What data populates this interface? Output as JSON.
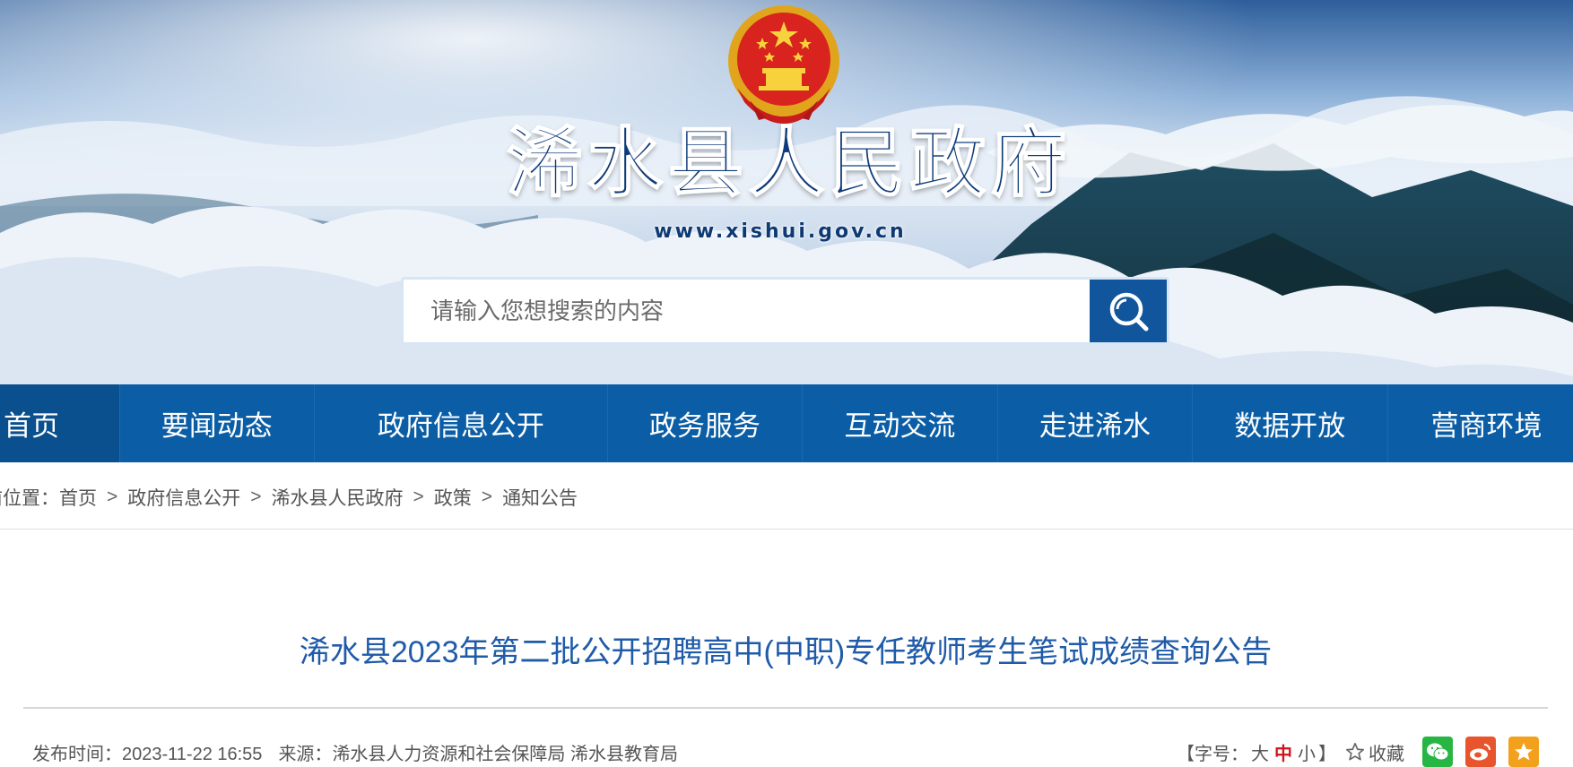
{
  "header": {
    "site_title": "浠水县人民政府",
    "site_url": "www.xishui.gov.cn",
    "emblem_icon": "national-emblem-icon"
  },
  "search": {
    "placeholder": "请输入您想搜索的内容",
    "value": "",
    "button_icon": "search-icon"
  },
  "nav": {
    "items": [
      {
        "label": "首页"
      },
      {
        "label": "要闻动态"
      },
      {
        "label": "政府信息公开"
      },
      {
        "label": "政务服务"
      },
      {
        "label": "互动交流"
      },
      {
        "label": "走进浠水"
      },
      {
        "label": "数据开放"
      },
      {
        "label": "营商环境"
      }
    ]
  },
  "breadcrumb": {
    "prefix": "前位置：",
    "items": [
      "首页",
      "政府信息公开",
      "浠水县人民政府",
      "政策",
      "通知公告"
    ],
    "separator": ">"
  },
  "article": {
    "title": "浠水县2023年第二批公开招聘高中(中职)专任教师考生笔试成绩查询公告",
    "publish_label": "发布时间：",
    "publish_time": "2023-11-22 16:55",
    "source_label": "来源：",
    "source": "浠水县人力资源和社会保障局 浠水县教育局"
  },
  "tools": {
    "font_size_open": "【字号：",
    "font_large": "大",
    "font_medium": "中",
    "font_small": "小",
    "font_size_close": "】",
    "favorite": "收藏",
    "share_icons": [
      "wechat-icon",
      "weibo-icon",
      "qzone-icon"
    ]
  },
  "colors": {
    "nav_background": "#0b5ea5",
    "title_blue": "#1f5ba8",
    "active_font_size": "#d0121b"
  }
}
